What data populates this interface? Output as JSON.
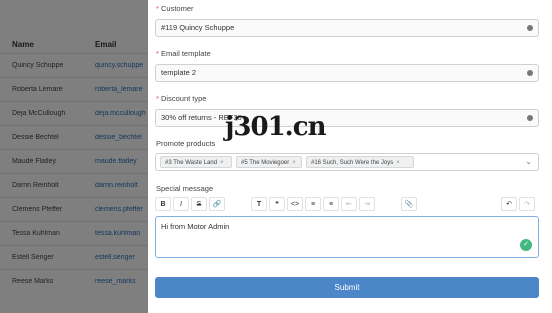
{
  "background_table": {
    "headers": {
      "name": "Name",
      "email": "Email"
    },
    "rows": [
      {
        "name": "Quincy Schuppe",
        "email": "quincy.schuppe"
      },
      {
        "name": "Roberta Lemare",
        "email": "roberta_lemare"
      },
      {
        "name": "Deja McCullough",
        "email": "deja.mccullough"
      },
      {
        "name": "Dessie Bechtel",
        "email": "dessie_bechtel"
      },
      {
        "name": "Maude Flatley",
        "email": "maude.flatley"
      },
      {
        "name": "Darrin Reinholt",
        "email": "darrin.reinholt"
      },
      {
        "name": "Clemens Pfeffer",
        "email": "clemens.pfeffer"
      },
      {
        "name": "Tessa Kuhlman",
        "email": "tessa.kuhlman"
      },
      {
        "name": "Estell Senger",
        "email": "estell.senger"
      },
      {
        "name": "Reese Marks",
        "email": "reese_marks"
      }
    ]
  },
  "form": {
    "customer": {
      "label": "Customer",
      "value": "#119 Quincy Schuppe"
    },
    "email_template": {
      "label": "Email template",
      "value": "template 2"
    },
    "discount_type": {
      "label": "Discount type",
      "value": "30% off returns - REF30"
    },
    "promote_products": {
      "label": "Promote products",
      "tags": [
        "#3 The Waste Land",
        "#5 The Moviegoer",
        "#16 Such, Such Were the Joys"
      ]
    },
    "special_message": {
      "label": "Special message",
      "value": "Hi from Motor Admin"
    },
    "toolbar": {
      "bold": "B",
      "italic": "I",
      "strike": "S",
      "link": "🔗",
      "heading": "T",
      "quote": "❝",
      "code": "<>",
      "bullet_list": "≡",
      "number_list": "≡",
      "outdent": "⇤",
      "indent": "⇥",
      "attach": "📎",
      "undo": "↶",
      "redo": "↷"
    },
    "submit_label": "Submit"
  },
  "watermark": "j301.cn",
  "colors": {
    "accent": "#4a86c8",
    "success": "#43b97f",
    "required": "#d9534f"
  }
}
